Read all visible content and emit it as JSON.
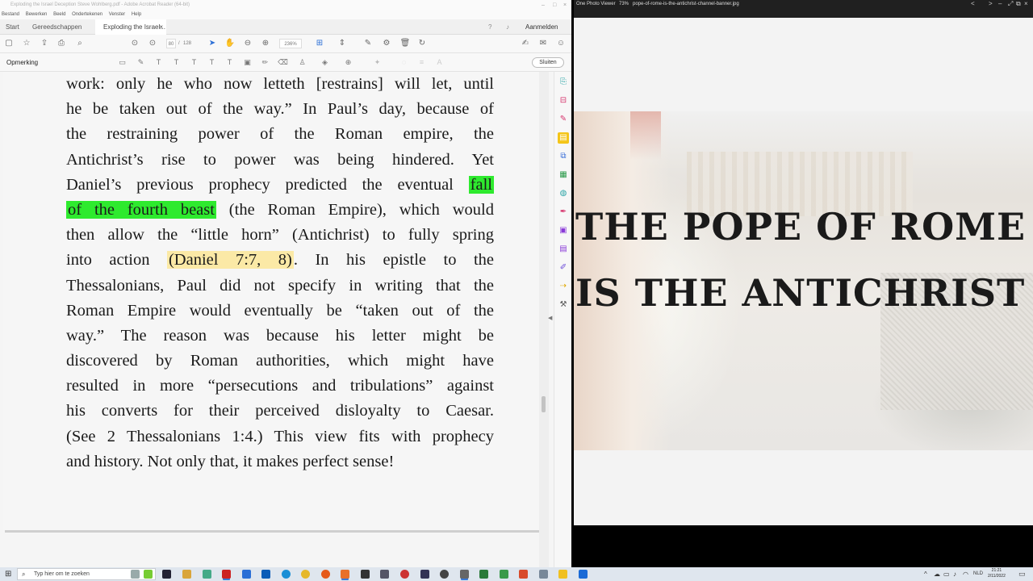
{
  "acrobat": {
    "window_title": "Exploding the Israel Deception Steve Wohlberg.pdf - Adobe Acrobat Reader (64-bit)",
    "menu": [
      "Bestand",
      "Bewerken",
      "Beeld",
      "Ondertekenen",
      "Venster",
      "Help"
    ],
    "tabs": {
      "start": "Start",
      "tools": "Gereedschappen",
      "document": "Exploding the Israel...",
      "close_x": "×"
    },
    "signin": "Aanmelden",
    "toolbar": {
      "page_current": "80",
      "page_sep": "/",
      "page_total": "128",
      "zoom": "236%"
    },
    "comment_bar": {
      "label": "Opmerking",
      "close": "Sluiten"
    },
    "document_lines": [
      {
        "t": "work: only he who now letteth [restrains] will let, until"
      },
      {
        "t": "he be taken out of the way.” In Paul’s day, because of"
      },
      {
        "t": "the restraining power of the Roman empire, the"
      },
      {
        "t": "Antichrist’s rise to power was being hindered. Yet"
      },
      {
        "pre": "Daniel’s previous prophecy predicted the eventual ",
        "hl": "fall",
        "post": ""
      },
      {
        "pre": "",
        "hl": "of the fourth beast",
        "post": " (the Roman Empire), which would"
      },
      {
        "t": "then allow the “little horn” (Antichrist) to fully spring"
      },
      {
        "pre": "into action ",
        "hly": "(Daniel 7:7, 8)",
        "post": ". In his epistle to the"
      },
      {
        "t": "Thessalonians, Paul did not specify in writing that the"
      },
      {
        "t": "Roman Empire would eventually be “taken out of the"
      },
      {
        "t": "way.” The reason was because his letter might be"
      },
      {
        "t": "discovered by Roman authorities, which might have"
      },
      {
        "t": "resulted in more “persecutions and tribulations” against"
      },
      {
        "t": "his converts for their perceived disloyalty to Caesar."
      },
      {
        "t": "(See 2 Thessalonians 1:4.) This view fits with prophecy"
      },
      {
        "t": "and history. Not only that, it makes perfect sense!"
      }
    ],
    "colors": {
      "highlight_green": "#2eea2e",
      "highlight_yellow": "#fbe9a6",
      "rail_active": "#f4c518"
    }
  },
  "photo_viewer": {
    "app_name": "One Photo Viewer",
    "zoom": "73%",
    "filename": "pope-of-rome-is-the-antichrist-channel-banner.jpg",
    "banner_line1": "THE POPE OF ROME",
    "banner_line2": "IS THE ANTICHRIST"
  },
  "taskbar": {
    "search_placeholder": "Typ hier om te zoeken",
    "language": "NLD",
    "time": "21:21",
    "date": "2/11/2022"
  }
}
